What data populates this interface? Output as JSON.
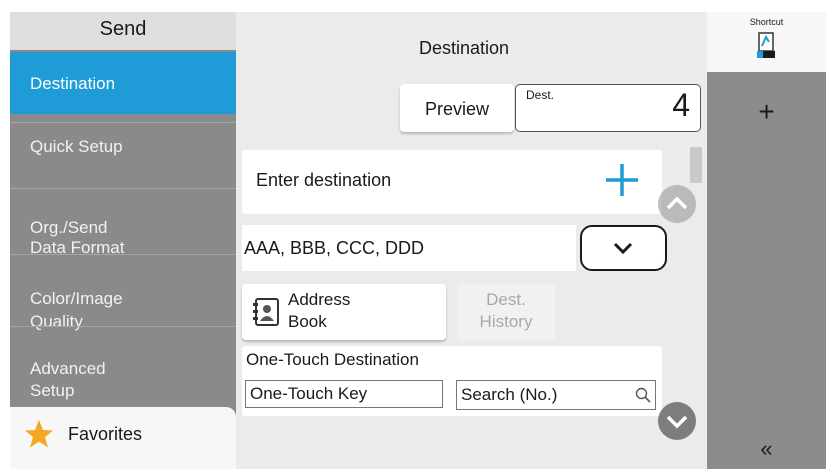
{
  "sidebar": {
    "header": "Send",
    "items": [
      {
        "label": "Destination"
      },
      {
        "label": "Quick Setup"
      },
      {
        "label": "Org./Send\nData Format"
      },
      {
        "label": "Color/Image\nQuality"
      },
      {
        "label": "Advanced\nSetup"
      }
    ],
    "favorites_label": "Favorites",
    "favorites_icon": "star-icon"
  },
  "main": {
    "title": "Destination",
    "preview_label": "Preview",
    "dest_label": "Dest.",
    "dest_count": "4",
    "enter_destination_label": "Enter destination",
    "destination_value": "AAA, BBB, CCC, DDD",
    "address_book_label": "Address\nBook",
    "dest_history_label": "Dest.\nHistory",
    "one_touch_title": "One-Touch Destination",
    "one_touch_key_label": "One-Touch Key",
    "search_no_label": "Search (No.)"
  },
  "right_panel": {
    "shortcut_label": "Shortcut",
    "add_label": "+",
    "collapse_label": "«"
  },
  "colors": {
    "accent": "#1f9cd8",
    "sidebar_bg": "#8a8a8a",
    "scroll_button": "#8a8a8a",
    "star": "#f5a623"
  }
}
